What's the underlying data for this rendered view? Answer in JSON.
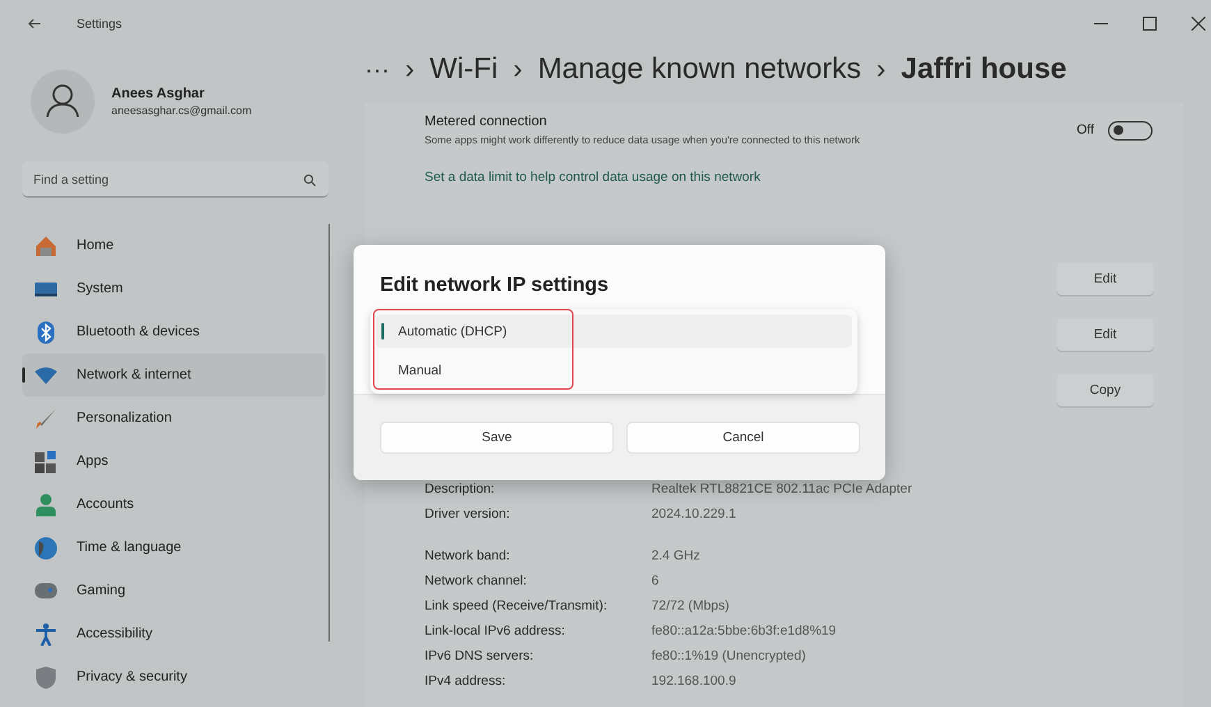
{
  "window": {
    "title": "Settings"
  },
  "account": {
    "name": "Anees Asghar",
    "email": "aneesasghar.cs@gmail.com"
  },
  "search": {
    "placeholder": "Find a setting"
  },
  "nav": [
    {
      "label": "Home",
      "kind": "home",
      "selected": false
    },
    {
      "label": "System",
      "kind": "system",
      "selected": false
    },
    {
      "label": "Bluetooth & devices",
      "kind": "bluetooth",
      "selected": false
    },
    {
      "label": "Network & internet",
      "kind": "network",
      "selected": true
    },
    {
      "label": "Personalization",
      "kind": "brush",
      "selected": false
    },
    {
      "label": "Apps",
      "kind": "apps",
      "selected": false
    },
    {
      "label": "Accounts",
      "kind": "person",
      "selected": false
    },
    {
      "label": "Time & language",
      "kind": "globe",
      "selected": false
    },
    {
      "label": "Gaming",
      "kind": "gamepad",
      "selected": false
    },
    {
      "label": "Accessibility",
      "kind": "accessibility",
      "selected": false
    },
    {
      "label": "Privacy & security",
      "kind": "shield",
      "selected": false
    }
  ],
  "breadcrumb": {
    "more": "···",
    "separator": "›",
    "items": [
      "Wi-Fi",
      "Manage known networks",
      "Jaffri house"
    ]
  },
  "metered": {
    "title": "Metered connection",
    "description": "Some apps might work differently to reduce data usage when you're connected to this network",
    "toggle_label": "Off",
    "on": false
  },
  "data_limit_link": "Set a data limit to help control data usage on this network",
  "row_buttons": [
    "Edit",
    "Edit",
    "Copy"
  ],
  "properties": [
    [
      {
        "label": "Description:",
        "value": "Realtek RTL8821CE 802.11ac PCIe Adapter"
      },
      {
        "label": "Driver version:",
        "value": "2024.10.229.1"
      }
    ],
    [
      {
        "label": "Network band:",
        "value": "2.4 GHz"
      },
      {
        "label": "Network channel:",
        "value": "6"
      },
      {
        "label": "Link speed (Receive/Transmit):",
        "value": "72/72 (Mbps)"
      },
      {
        "label": "Link-local IPv6 address:",
        "value": "fe80::a12a:5bbe:6b3f:e1d8%19"
      },
      {
        "label": "IPv6 DNS servers:",
        "value": "fe80::1%19 (Unencrypted)"
      },
      {
        "label": "IPv4 address:",
        "value": "192.168.100.9"
      }
    ]
  ],
  "dialog": {
    "title": "Edit network IP settings",
    "options": [
      {
        "label": "Automatic (DHCP)",
        "selected": true
      },
      {
        "label": "Manual",
        "selected": false
      }
    ],
    "buttons": [
      "Save",
      "Cancel"
    ]
  }
}
